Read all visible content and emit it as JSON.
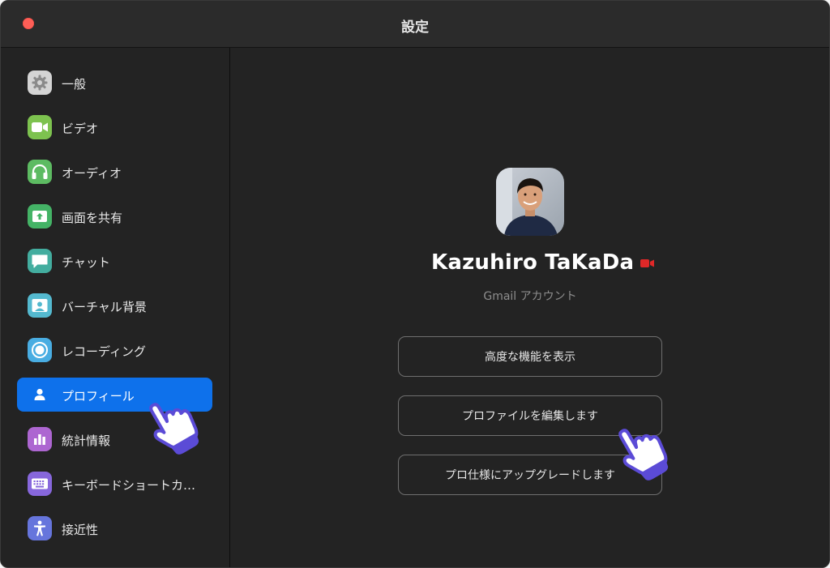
{
  "window": {
    "title": "設定"
  },
  "sidebar": {
    "items": [
      {
        "label": "一般",
        "icon": "gear-icon",
        "color": "#d9d9d9"
      },
      {
        "label": "ビデオ",
        "icon": "video-camera-icon",
        "color": "#85c85a"
      },
      {
        "label": "オーディオ",
        "icon": "headphones-icon",
        "color": "#6ac26c"
      },
      {
        "label": "画面を共有",
        "icon": "share-screen-icon",
        "color": "#4ab769"
      },
      {
        "label": "チャット",
        "icon": "chat-bubble-icon",
        "color": "#4bb5a7"
      },
      {
        "label": "バーチャル背景",
        "icon": "virtual-background-icon",
        "color": "#5bc1d6"
      },
      {
        "label": "レコーディング",
        "icon": "record-icon",
        "color": "#4fb4e8"
      },
      {
        "label": "プロフィール",
        "icon": "person-icon",
        "color": "#0e71eb",
        "active": true
      },
      {
        "label": "統計情報",
        "icon": "bar-chart-icon",
        "color": "#b46bd6"
      },
      {
        "label": "キーボードショートカ…",
        "icon": "keyboard-icon",
        "color": "#8a6de0"
      },
      {
        "label": "接近性",
        "icon": "accessibility-icon",
        "color": "#6a78e0"
      }
    ]
  },
  "profile": {
    "name": "Kazuhiro TaKaDa",
    "account_type": "Gmail アカウント",
    "buttons": {
      "advanced": "高度な機能を表示",
      "edit": "プロファイルを編集します",
      "upgrade": "プロ仕様にアップグレードします"
    }
  },
  "colors": {
    "accent": "#0e71eb",
    "record": "#e02828"
  }
}
